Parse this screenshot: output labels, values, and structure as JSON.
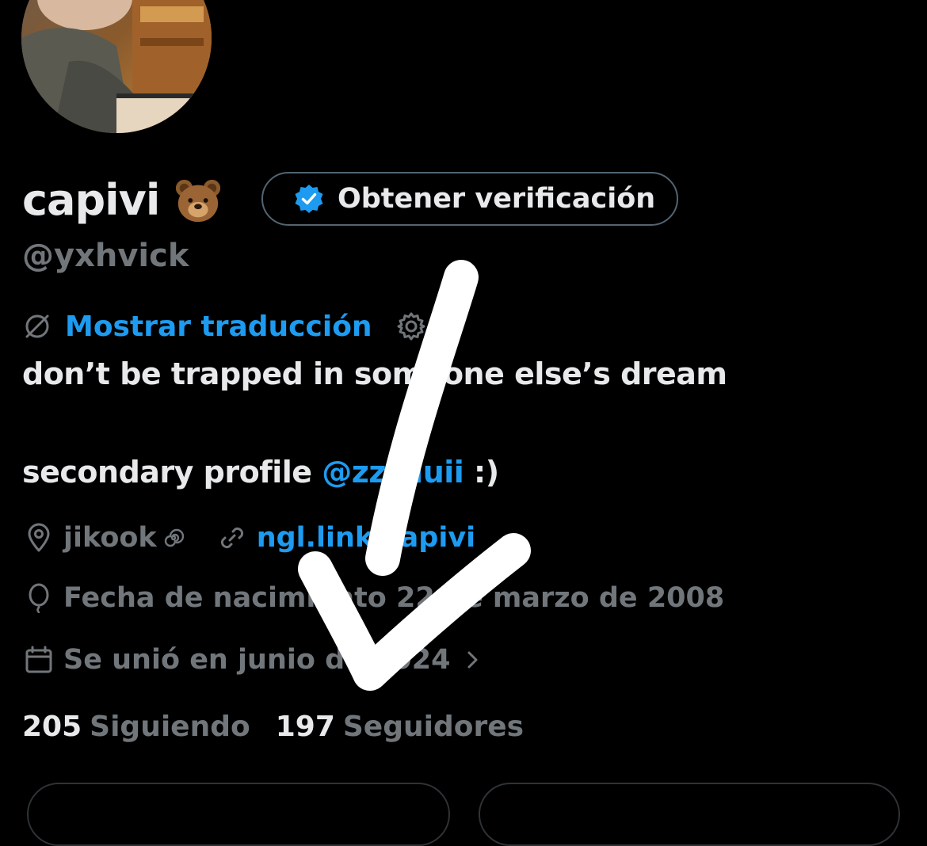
{
  "profile": {
    "display_name": "capivi",
    "emoji_icon": "bear-face-icon",
    "handle": "@yxhvick",
    "verify_button": "Obtener verificación",
    "translate": "Mostrar traducción",
    "bio_line1": "don’t be trapped in someone else’s dream",
    "bio_line2_prefix": "secondary profile ",
    "bio_mention": "@zzzlluii",
    "bio_line2_suffix": " :)",
    "location": "jikook",
    "website": "ngl.link/capivi",
    "birthday": "Fecha de nacimiento 22 de marzo de 2008",
    "joined": "Se unió en junio de 2024",
    "following_count": "205",
    "following_label": "Siguiendo",
    "followers_count": "197",
    "followers_label": "Seguidores"
  },
  "colors": {
    "background": "#000000",
    "text": "#e7e9ea",
    "muted": "#71767b",
    "accent": "#1d9bf0",
    "border": "#536471",
    "overlay_mark": "#ffffff"
  },
  "icons": {
    "verified": "verified-badge-icon",
    "translate": "translate-globe-icon",
    "settings": "gear-icon",
    "location": "location-pin-icon",
    "location_suffix": "spiral-icon",
    "link": "link-icon",
    "birthday": "balloon-icon",
    "calendar": "calendar-icon",
    "chevron": "chevron-right-icon"
  }
}
